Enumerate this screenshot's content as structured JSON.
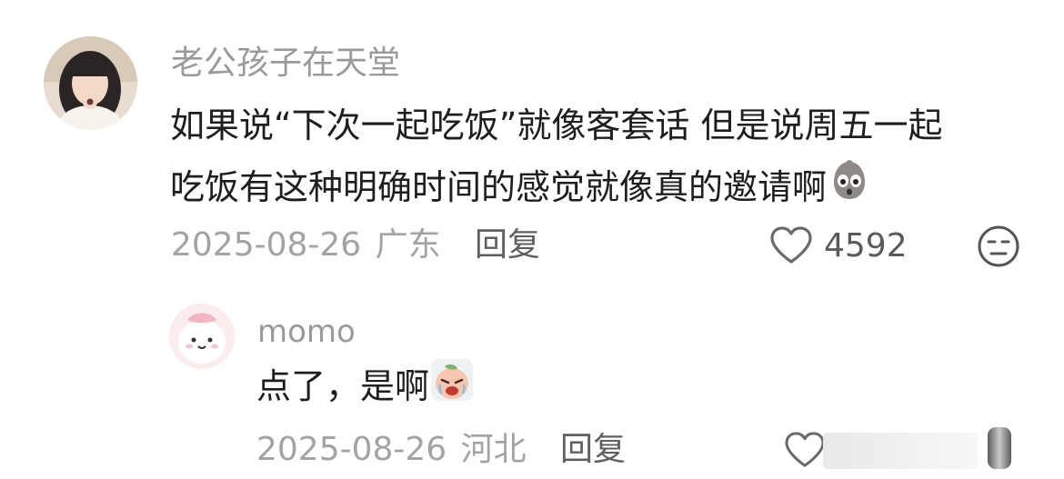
{
  "comment": {
    "username": "老公孩子在天堂",
    "text_line1": "如果说“下次一起吃饭”就像客套话 但是说周五一起",
    "text_line2": "吃饭有这种明确时间的感觉就像真的邀请啊",
    "emoji": "surprised-face-emoji",
    "date": "2025-08-26",
    "location": "广东",
    "reply_label": "回复",
    "like_count": "4592",
    "reaction_icon": "neutral-face-icon"
  },
  "reply": {
    "username": "momo",
    "text": "点了，是啊",
    "emoji": "crying-peach-emoji",
    "date": "2025-08-26",
    "location": "河北",
    "reply_label": "回复"
  },
  "colors": {
    "username": "#9a9a9a",
    "body_text": "#1e1e1e",
    "meta": "#a3a3a3",
    "reply_label": "#5f5f5f"
  }
}
